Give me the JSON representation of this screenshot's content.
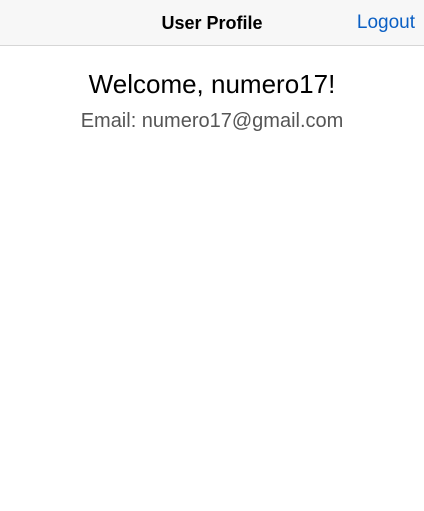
{
  "header": {
    "title": "User Profile",
    "logout_label": "Logout"
  },
  "profile": {
    "welcome_text": "Welcome, numero17!",
    "email_text": "Email: numero17@gmail.com"
  },
  "colors": {
    "link": "#0a5fc4",
    "header_bg": "#f7f7f7",
    "secondary_text": "#555555"
  }
}
